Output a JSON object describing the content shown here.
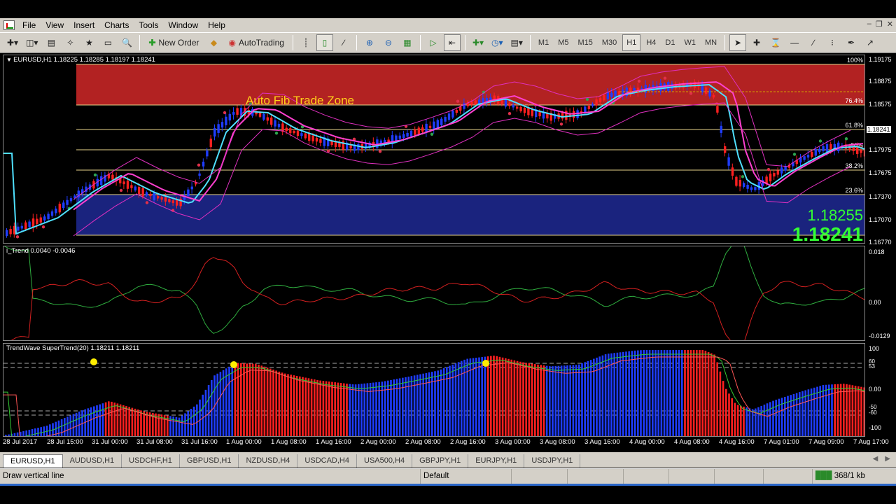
{
  "menu": [
    "File",
    "View",
    "Insert",
    "Charts",
    "Tools",
    "Window",
    "Help"
  ],
  "toolbar": {
    "new_order": "New Order",
    "autotrading": "AutoTrading",
    "timeframes": [
      "M1",
      "M5",
      "M15",
      "M30",
      "H1",
      "H4",
      "D1",
      "W1",
      "MN"
    ],
    "active_timeframe": "H1"
  },
  "main_chart": {
    "title": "EURUSD,H1  1.18225 1.18285 1.18197 1.18241",
    "zone_label": "Auto Fib Trade Zone",
    "fib_levels": [
      "100%",
      "76.4%",
      "61.8%",
      "50%",
      "38.2%",
      "23.6%"
    ],
    "price_labels": [
      "1.19175",
      "1.18875",
      "1.18575",
      "1.18241",
      "1.17975",
      "1.17675",
      "1.17370",
      "1.17070",
      "1.16770"
    ],
    "current_price_tag": "1.18241",
    "big_price_1": "1.18255",
    "big_price_2": "1.18241"
  },
  "indicator1": {
    "title": "i_Trend 0.0040 -0.0046",
    "axis": [
      "0.018",
      "0.00",
      "-0.0129"
    ]
  },
  "indicator2": {
    "title": "TrendWave  SuperTrend(20) 1.18211 1.18211",
    "axis": [
      "100",
      "60",
      "53",
      "0.00",
      "-50",
      "-60",
      "-100"
    ]
  },
  "time_labels": [
    "28 Jul 2017",
    "28 Jul 15:00",
    "31 Jul 00:00",
    "31 Jul 08:00",
    "31 Jul 16:00",
    "1 Aug 00:00",
    "1 Aug 08:00",
    "1 Aug 16:00",
    "2 Aug 00:00",
    "2 Aug 08:00",
    "2 Aug 16:00",
    "3 Aug 00:00",
    "3 Aug 08:00",
    "3 Aug 16:00",
    "4 Aug 00:00",
    "4 Aug 08:00",
    "4 Aug 16:00",
    "7 Aug 01:00",
    "7 Aug 09:00",
    "7 Aug 17:00"
  ],
  "tabs": [
    "EURUSD,H1",
    "AUDUSD,H1",
    "USDCHF,H1",
    "GBPUSD,H1",
    "NZDUSD,H4",
    "USDCAD,H4",
    "USA500,H4",
    "GBPJPY,H1",
    "EURJPY,H1",
    "USDJPY,H1"
  ],
  "status": {
    "hint": "Draw vertical line",
    "profile": "Default",
    "traffic": "368/1 kb"
  },
  "colors": {
    "fib_red_zone": "#b22222",
    "fib_blue_zone": "#1a237e",
    "bull_candle": "#1f3dff",
    "bear_candle": "#ff2020",
    "ma_cyan": "#4fe0ff",
    "ma_magenta": "#ff40d0",
    "big_price": "#33ff33"
  }
}
